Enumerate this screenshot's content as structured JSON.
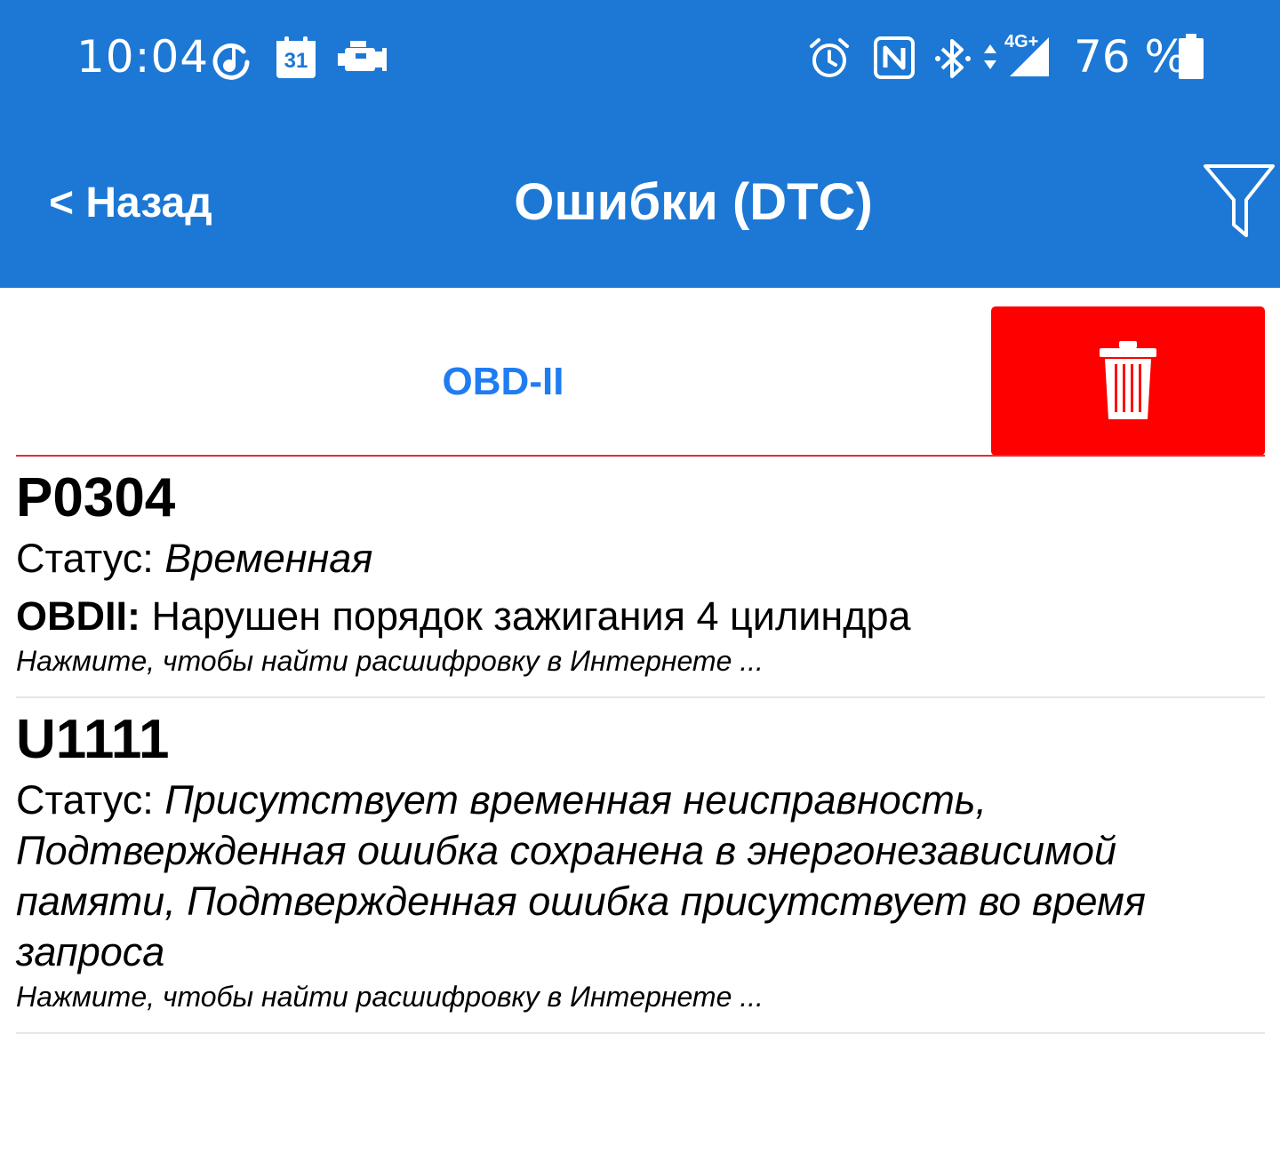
{
  "status_bar": {
    "time": "10:04",
    "calendar_day": "31",
    "network": "4G+",
    "battery": "76 %",
    "icons": [
      "music-notification-icon",
      "calendar-icon",
      "check-engine-icon",
      "alarm-icon",
      "nfc-icon",
      "bluetooth-icon",
      "data-arrows-icon",
      "signal-icon",
      "battery-icon"
    ]
  },
  "header": {
    "back_label": "< Назад",
    "title": "Ошибки (DTC)",
    "filter_icon": "filter-icon"
  },
  "protocol_tab": "OBD-II",
  "delete_icon": "trash-icon",
  "colors": {
    "header_bg": "#1c78d4",
    "delete_bg": "#fe0000",
    "tab_text": "#1f7cf2",
    "divider": "#e03030"
  },
  "dtc_items": [
    {
      "code": "P0304",
      "status_label": "Статус:",
      "status_value": "Временная",
      "proto_label": "OBDII:",
      "description": "Нарушен порядок зажигания 4 цилиндра",
      "hint": "Нажмите, чтобы найти расшифровку в Интернете ..."
    },
    {
      "code": "U1111",
      "status_label": "Статус:",
      "status_value": "Присутствует временная неисправность, Подтвержденная ошибка сохранена в энергонезависимой памяти, Подтвержденная ошибка присутствует во время запроса",
      "hint": "Нажмите, чтобы найти расшифровку в Интернете ..."
    }
  ]
}
